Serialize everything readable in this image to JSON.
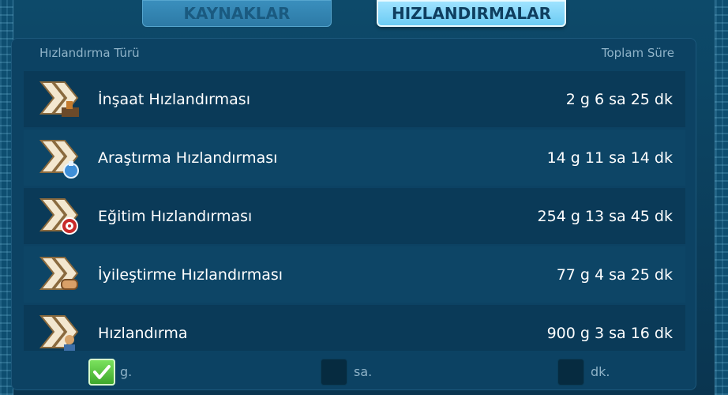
{
  "tabs": {
    "resources": "KAYNAKLAR",
    "speedups": "HIZLANDIRMALAR"
  },
  "table": {
    "col_type": "Hızlandırma Türü",
    "col_total": "Toplam Süre",
    "rows": [
      {
        "name": "İnşaat Hızlandırması",
        "time": "2 g 6 sa 25 dk",
        "icon": "construction-speedup-icon"
      },
      {
        "name": "Araştırma Hızlandırması",
        "time": "14 g 11 sa 14 dk",
        "icon": "research-speedup-icon"
      },
      {
        "name": "Eğitim Hızlandırması",
        "time": "254 g 13 sa 45 dk",
        "icon": "training-speedup-icon"
      },
      {
        "name": "İyileştirme Hızlandırması",
        "time": "77 g 4 sa 25 dk",
        "icon": "healing-speedup-icon"
      },
      {
        "name": "Hızlandırma",
        "time": "900 g 3 sa 16 dk",
        "icon": "universal-speedup-icon"
      }
    ]
  },
  "filters": {
    "days": {
      "label": "g.",
      "checked": true
    },
    "hours": {
      "label": "sa.",
      "checked": false
    },
    "minutes": {
      "label": "dk.",
      "checked": false
    }
  }
}
